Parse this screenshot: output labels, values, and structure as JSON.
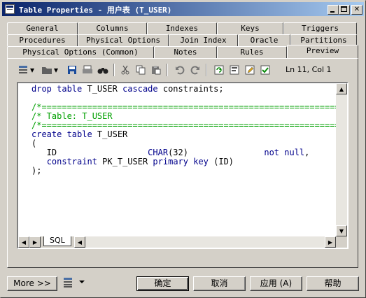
{
  "window": {
    "title": "Table Properties - 用户表 (T_USER)"
  },
  "tabs": {
    "row1": [
      "General",
      "Columns",
      "Indexes",
      "Keys",
      "Triggers"
    ],
    "row2": [
      "Procedures",
      "Physical Options",
      "Join Index",
      "Oracle",
      "Partitions"
    ],
    "row3": [
      "Physical Options (Common)",
      "Notes",
      "Rules",
      "Preview"
    ],
    "active": "Preview"
  },
  "toolbar": {
    "icons": [
      "format-icon",
      "dropdown-arrow-icon",
      "folder-icon",
      "dropdown-arrow-icon",
      "save-icon",
      "print-icon",
      "find-icon",
      "cut-icon",
      "copy-icon",
      "paste-icon",
      "undo-icon",
      "redo-icon",
      "refresh-icon",
      "run-script-icon",
      "edit-icon",
      "check-icon"
    ],
    "cursor_position": "Ln 11, Col 1"
  },
  "editor": {
    "lines": [
      [
        {
          "t": "drop table ",
          "c": "kw"
        },
        {
          "t": "T_USER ",
          "c": "pl"
        },
        {
          "t": "cascade ",
          "c": "kw"
        },
        {
          "t": "constraints;",
          "c": "pl"
        }
      ],
      [],
      [
        {
          "t": "/*==============================================================",
          "c": "cm"
        }
      ],
      [
        {
          "t": "/* Table: T_USER",
          "c": "cm"
        }
      ],
      [
        {
          "t": "/*==============================================================",
          "c": "cm"
        }
      ],
      [
        {
          "t": "create table ",
          "c": "kw"
        },
        {
          "t": "T_USER",
          "c": "pl"
        }
      ],
      [
        {
          "t": "(",
          "c": "pl"
        }
      ],
      [
        {
          "t": "   ID                  ",
          "c": "pl"
        },
        {
          "t": "CHAR",
          "c": "kw"
        },
        {
          "t": "(32)               ",
          "c": "pl"
        },
        {
          "t": "not null",
          "c": "kw"
        },
        {
          "t": ",",
          "c": "pl"
        }
      ],
      [
        {
          "t": "   ",
          "c": "pl"
        },
        {
          "t": "constraint ",
          "c": "kw"
        },
        {
          "t": "PK_T_USER ",
          "c": "pl"
        },
        {
          "t": "primary key ",
          "c": "kw"
        },
        {
          "t": "(ID)",
          "c": "pl"
        }
      ],
      [
        {
          "t": ");",
          "c": "pl"
        }
      ]
    ],
    "sheet_tab": "SQL"
  },
  "buttons": {
    "more": "More >>",
    "ok": "确定",
    "cancel": "取消",
    "apply": "应用 (A)",
    "help": "帮助"
  },
  "colors": {
    "keyword": "#00008b",
    "comment": "#00a000",
    "titlebar_start": "#0a246a",
    "titlebar_end": "#a6caf0"
  }
}
